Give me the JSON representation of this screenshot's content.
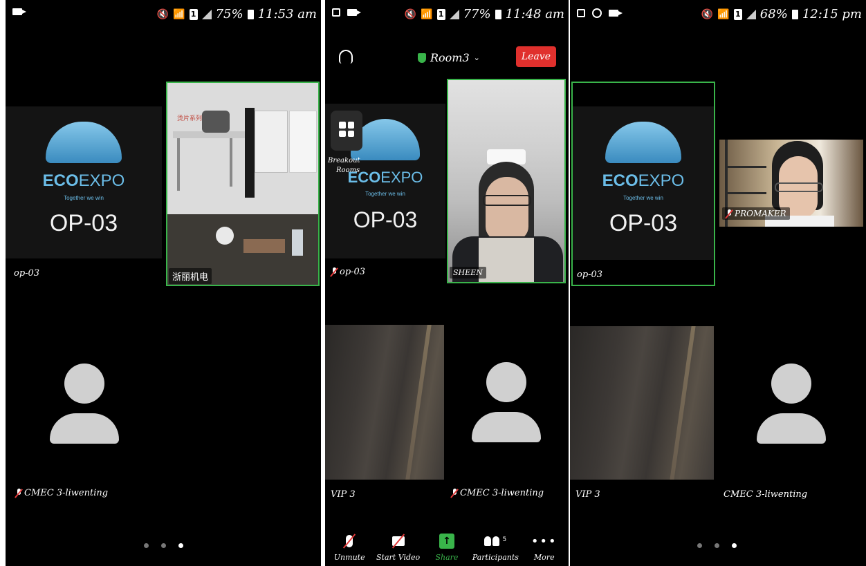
{
  "screen1": {
    "status": {
      "battery": "75%",
      "time": "11:53 am"
    },
    "logo_tile": {
      "brand_left": "ECO",
      "brand_right": "EXPO",
      "tagline": "Together we win",
      "code": "OP-03"
    },
    "tile1_name": "op-03",
    "tile2_name": "浙丽机电",
    "tile2_caption": "烫片系列",
    "tile3_name": "CMEC 3-liwenting",
    "page_dots": 3,
    "active_dot": 3
  },
  "screen2": {
    "status": {
      "battery": "77%",
      "time": "11:48 am"
    },
    "room": "Room3",
    "leave_label": "Leave",
    "breakout_label_1": "Breakout",
    "breakout_label_2": "Rooms",
    "logo_tile": {
      "brand_left": "ECO",
      "brand_right": "EXPO",
      "tagline": "Together we win",
      "code": "OP-03"
    },
    "tile1_name": "op-03",
    "tile2_name": "SHEEN",
    "tile3_name": "VIP 3",
    "tile4_name": "CMEC 3-liwenting",
    "toolbar": {
      "unmute": "Unmute",
      "start_video": "Start Video",
      "share": "Share",
      "participants": "Participants",
      "participants_count": "5",
      "more": "More"
    },
    "accent_color": "#39b44a",
    "leave_color": "#e0302d"
  },
  "screen3": {
    "status": {
      "battery": "68%",
      "time": "12:15 pm"
    },
    "logo_tile": {
      "brand_left": "ECO",
      "brand_right": "EXPO",
      "tagline": "Together we win",
      "code": "OP-03"
    },
    "tile1_name": "op-03",
    "tile2_name": "PROMAKER",
    "tile3_name": "VIP 3",
    "tile4_name": "CMEC 3-liwenting",
    "page_dots": 3,
    "active_dot": 3
  }
}
